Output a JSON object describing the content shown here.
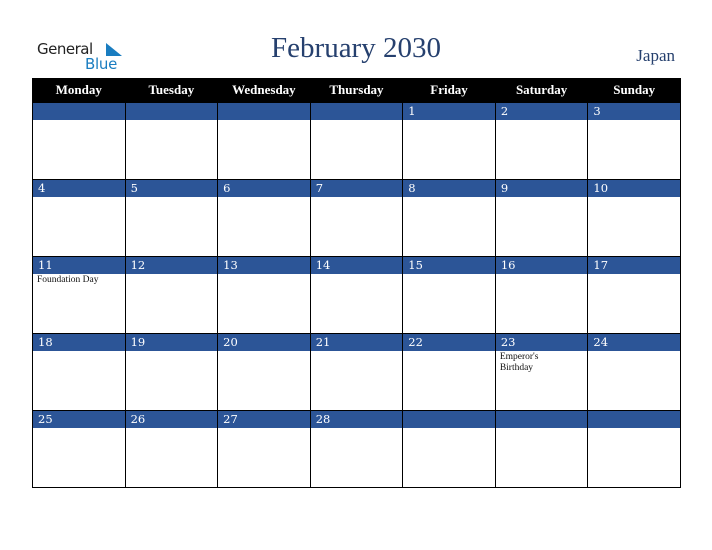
{
  "logo": {
    "line1": "General",
    "line2": "Blue"
  },
  "title": "February 2030",
  "country": "Japan",
  "colors": {
    "header_bg": "#000000",
    "date_bar": "#2c5597",
    "title": "#26406e",
    "logo_blue": "#1a7dc0"
  },
  "weekdays": [
    "Monday",
    "Tuesday",
    "Wednesday",
    "Thursday",
    "Friday",
    "Saturday",
    "Sunday"
  ],
  "weeks": [
    [
      {
        "day": ""
      },
      {
        "day": ""
      },
      {
        "day": ""
      },
      {
        "day": ""
      },
      {
        "day": "1"
      },
      {
        "day": "2"
      },
      {
        "day": "3"
      }
    ],
    [
      {
        "day": "4"
      },
      {
        "day": "5"
      },
      {
        "day": "6"
      },
      {
        "day": "7"
      },
      {
        "day": "8"
      },
      {
        "day": "9"
      },
      {
        "day": "10"
      }
    ],
    [
      {
        "day": "11",
        "holiday": "Foundation Day"
      },
      {
        "day": "12"
      },
      {
        "day": "13"
      },
      {
        "day": "14"
      },
      {
        "day": "15"
      },
      {
        "day": "16"
      },
      {
        "day": "17"
      }
    ],
    [
      {
        "day": "18"
      },
      {
        "day": "19"
      },
      {
        "day": "20"
      },
      {
        "day": "21"
      },
      {
        "day": "22"
      },
      {
        "day": "23",
        "holiday": "Emperor's Birthday"
      },
      {
        "day": "24"
      }
    ],
    [
      {
        "day": "25"
      },
      {
        "day": "26"
      },
      {
        "day": "27"
      },
      {
        "day": "28"
      },
      {
        "day": ""
      },
      {
        "day": ""
      },
      {
        "day": ""
      }
    ]
  ]
}
